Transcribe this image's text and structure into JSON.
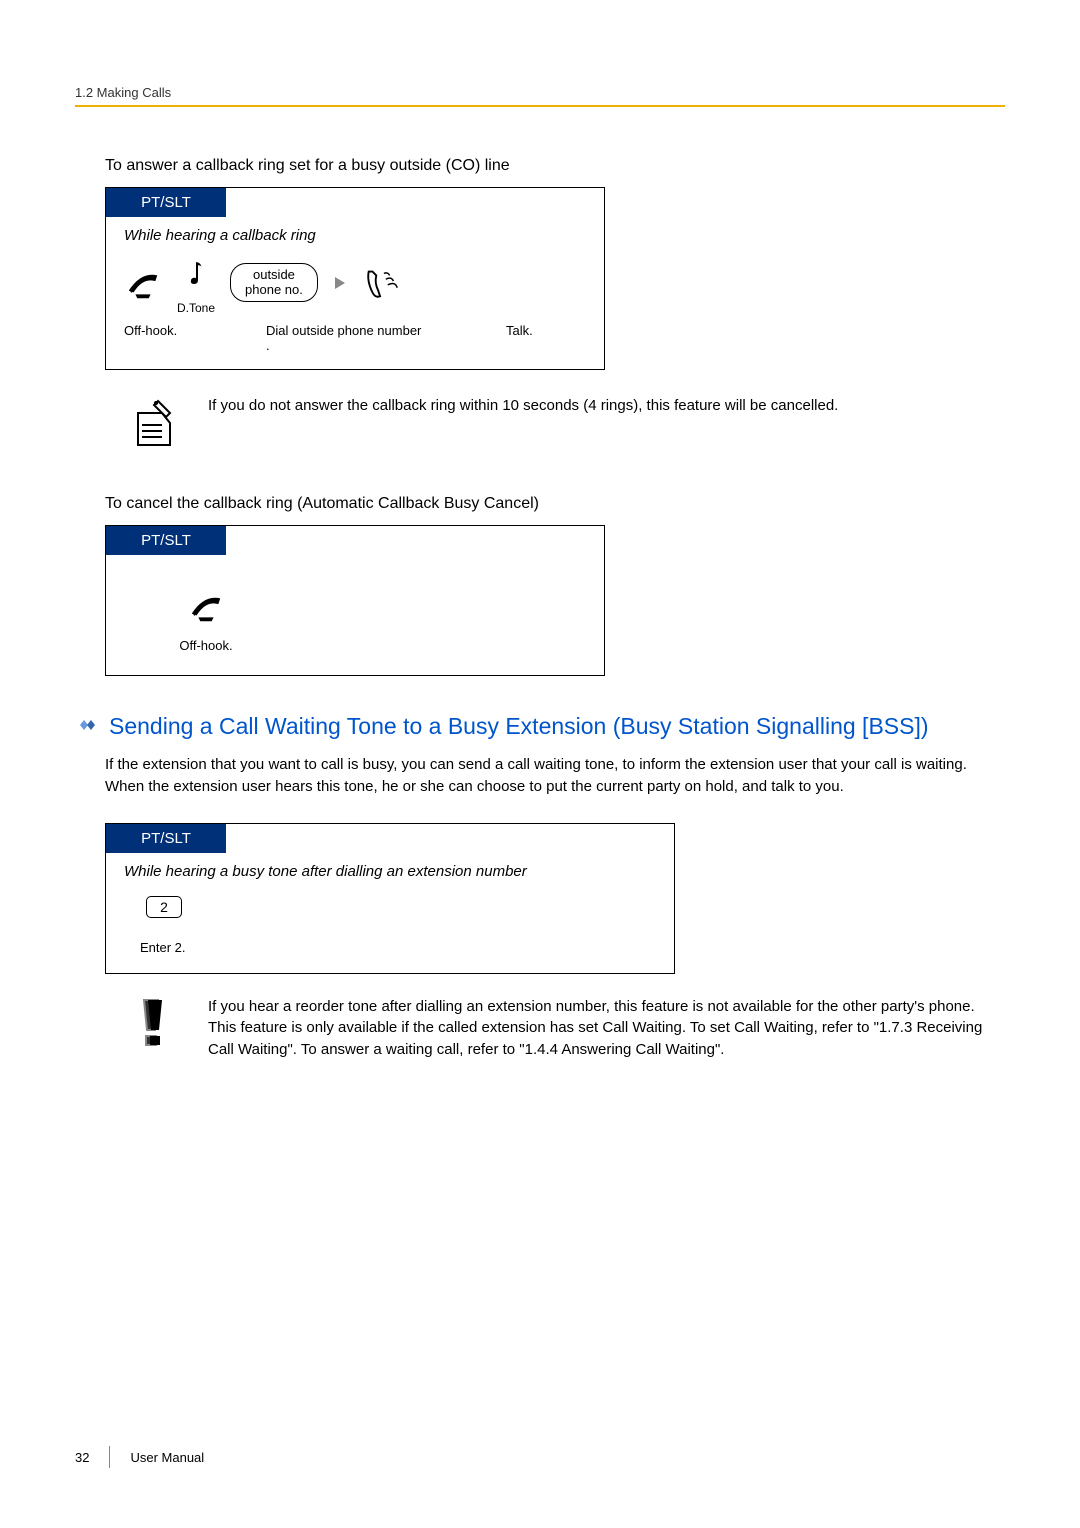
{
  "header": {
    "breadcrumb": "1.2 Making Calls"
  },
  "section1": {
    "heading": "To answer a callback ring set for a busy outside (CO) line",
    "diagram": {
      "title": "PT/SLT",
      "subtitle": "While hearing a callback ring",
      "dtone": "D.Tone",
      "lozenge_line1": "outside",
      "lozenge_line2": "phone no.",
      "caption_offhook": "Off-hook.",
      "caption_dial": "Dial outside phone number .",
      "caption_talk": "Talk."
    },
    "note": "If you do not answer the callback ring within 10 seconds (4 rings), this feature will be cancelled."
  },
  "section2": {
    "heading": "To cancel the callback ring (Automatic Callback Busy Cancel)",
    "diagram": {
      "title": "PT/SLT",
      "caption_offhook": "Off-hook."
    }
  },
  "section3": {
    "heading": " Sending a Call Waiting Tone to a Busy Extension (Busy Station Signalling [BSS])",
    "body": "If the extension that you want to call is busy, you can send a call waiting tone, to inform the extension user that your call is waiting. When the extension user hears this tone, he or she can choose to put the current party on hold, and talk to you.",
    "diagram": {
      "title": "PT/SLT",
      "subtitle": "While hearing a busy tone after dialling an extension number",
      "key": "2",
      "caption": "Enter 2."
    },
    "warning": "If you hear a reorder tone after dialling an extension number,         this feature is not available for the other party's phone. This feature is only available if the called extension has set Call Waiting. To set Call Waiting, refer to \"1.7.3 Receiving Call Waiting\". To answer a waiting call, refer to \"1.4.4 Answering Call Waiting\"."
  },
  "footer": {
    "page": "32",
    "label": "User Manual"
  }
}
